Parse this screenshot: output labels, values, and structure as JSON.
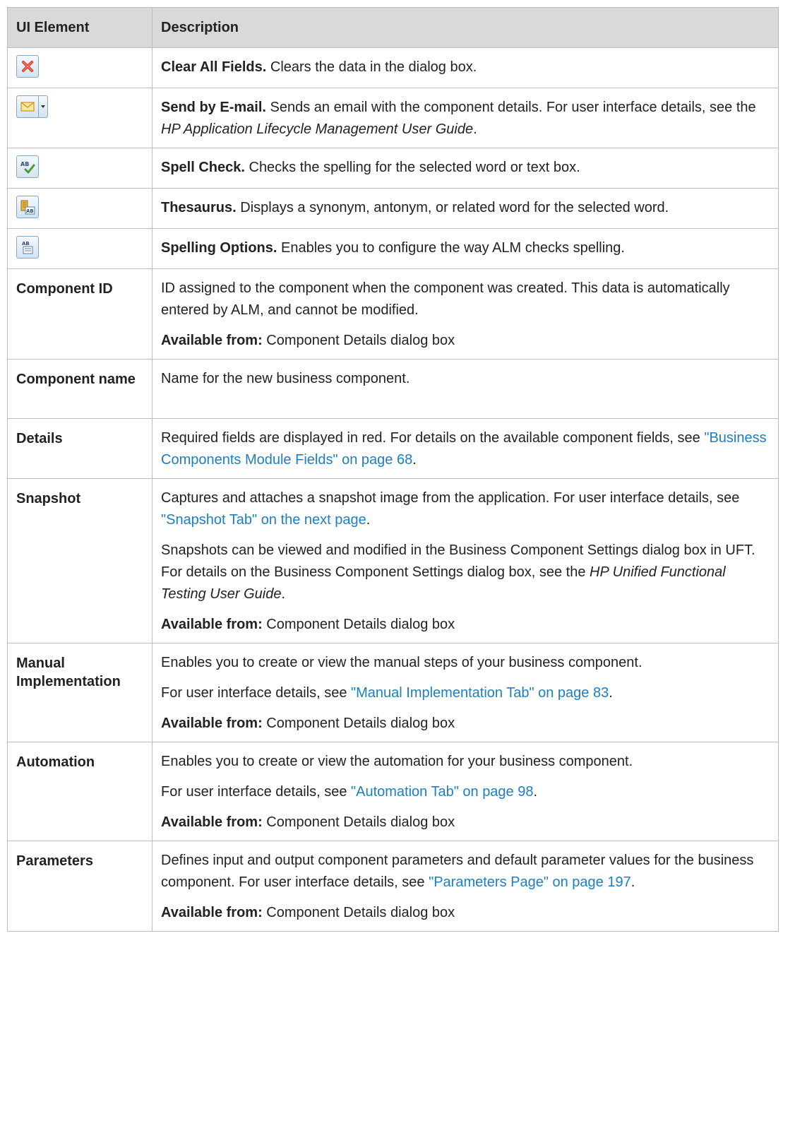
{
  "header": {
    "col_element": "UI Element",
    "col_description": "Description"
  },
  "icon_rows": [
    {
      "icon": "clear-fields-icon",
      "title": "Clear All Fields.",
      "text": " Clears the data in the dialog box."
    },
    {
      "icon": "send-email-icon",
      "title": "Send by E-mail.",
      "text": " Sends an email with the component details. For user interface details, see the ",
      "ref": "HP Application Lifecycle Management User Guide",
      "tail": "."
    },
    {
      "icon": "spell-check-icon",
      "title": "Spell Check.",
      "text": " Checks the spelling for the selected word or text box."
    },
    {
      "icon": "thesaurus-icon",
      "title": "Thesaurus.",
      "text": " Displays a synonym, antonym, or related word for the selected word."
    },
    {
      "icon": "spelling-options-icon",
      "title": "Spelling Options.",
      "text": " Enables you to configure the way ALM checks spelling."
    }
  ],
  "available_label": "Available from:",
  "available_value": " Component Details dialog box",
  "rows": {
    "component_id": {
      "element": "Component ID",
      "desc": "ID assigned to the component when the component was created. This data is automatically entered by ALM, and cannot be modified."
    },
    "component_name": {
      "element": "Component name",
      "desc": "Name for the new business component."
    },
    "details": {
      "element": "Details",
      "desc": "Required fields are displayed in red. For details on the available component fields, see ",
      "link": "\"Business Components Module Fields\" on page 68",
      "tail": "."
    },
    "snapshot": {
      "element": "Snapshot",
      "desc1": "Captures and attaches a snapshot image from the application. For user interface details, see ",
      "link": "\"Snapshot Tab\" on the next page",
      "tail1": ".",
      "desc2": "Snapshots can be viewed and modified in the Business Component Settings dialog box in UFT. For details on the Business Component Settings dialog box, see the ",
      "ref": "HP Unified Functional Testing User Guide",
      "tail2": "."
    },
    "manual": {
      "element": "Manual Implementation",
      "desc1": "Enables you to create or view the manual steps of your business component.",
      "desc2": "For user interface details, see ",
      "link": "\"Manual Implementation Tab\" on page 83",
      "tail2": "."
    },
    "automation": {
      "element": "Automation",
      "desc1": "Enables you to create or view the automation for your business component.",
      "desc2": "For user interface details, see ",
      "link": "\"Automation Tab\" on page 98",
      "tail2": "."
    },
    "parameters": {
      "element": "Parameters",
      "desc": "Defines input and output component parameters and default parameter values for the business component. For user interface details, see ",
      "link": "\"Parameters Page\" on page 197",
      "tail": "."
    }
  }
}
